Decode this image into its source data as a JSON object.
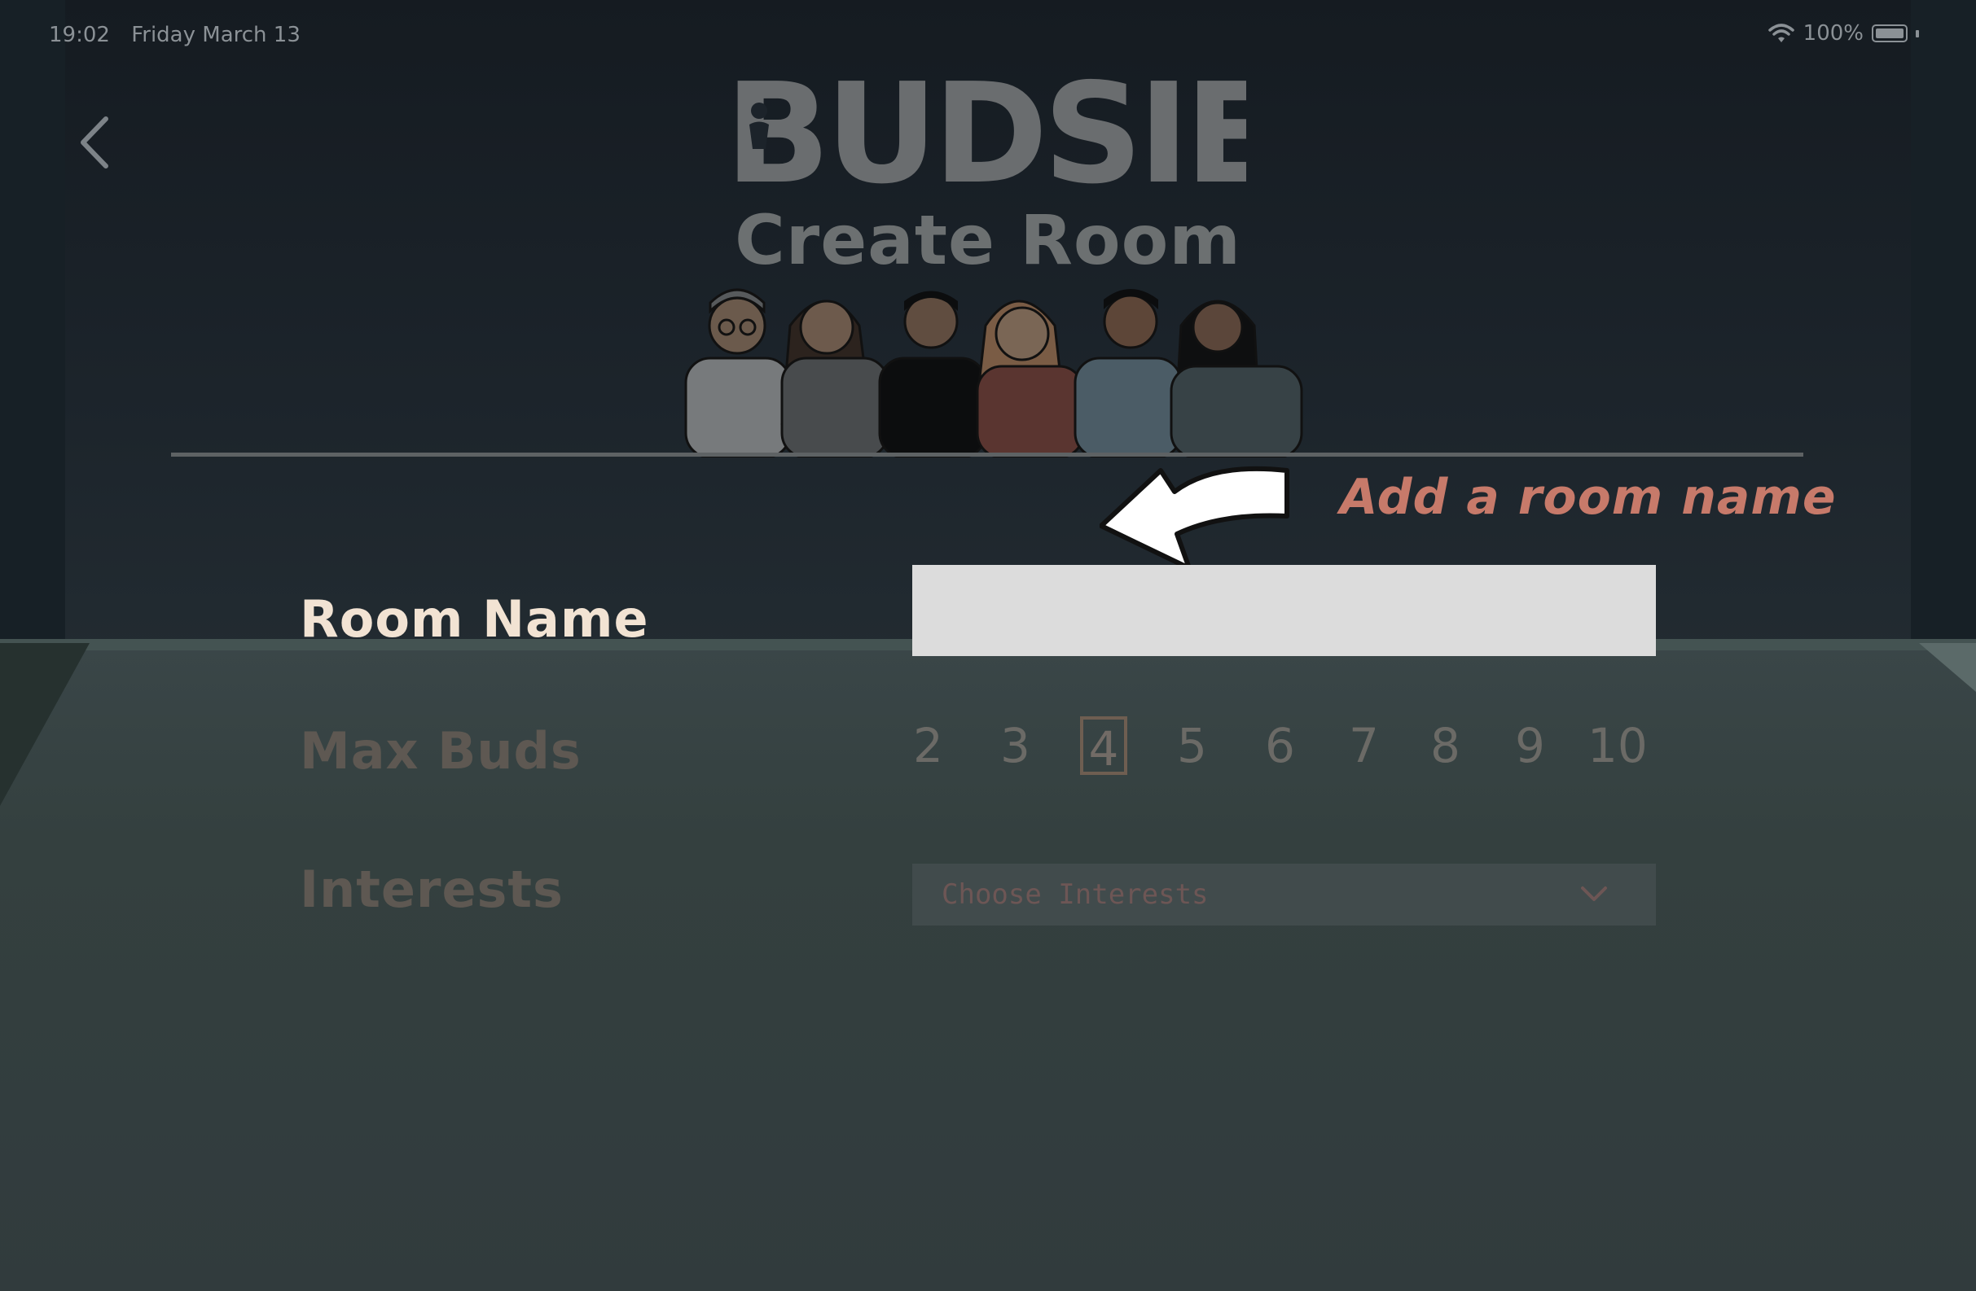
{
  "status_bar": {
    "time": "19:02",
    "date": "Friday March 13",
    "battery": "100%"
  },
  "header": {
    "logo_text": "BUDSIES",
    "title": "Create Room"
  },
  "hint": {
    "text": "Add a room name"
  },
  "form": {
    "room_name_label": "Room Name",
    "room_name_value": "",
    "max_buds_label": "Max Buds",
    "max_buds_options": [
      "2",
      "3",
      "4",
      "5",
      "6",
      "7",
      "8",
      "9",
      "10"
    ],
    "max_buds_selected": "4",
    "interests_label": "Interests",
    "interests_placeholder": "Choose Interests"
  },
  "colors": {
    "hint": "#c77a6a",
    "active_label": "#f2e3d3",
    "dim_label": "#5e5852"
  }
}
